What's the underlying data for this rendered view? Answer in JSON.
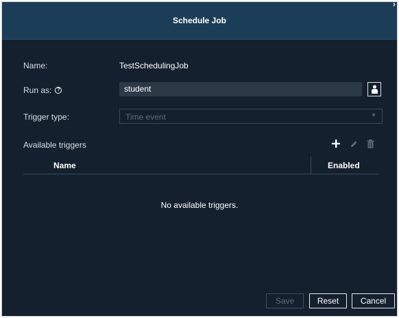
{
  "dialog": {
    "title": "Schedule Job",
    "corner_glyph": "›"
  },
  "form": {
    "name_label": "Name:",
    "name_value": "TestSchedulingJob",
    "runas_label": "Run as:",
    "runas_help_glyph": "?",
    "runas_value": "student",
    "user_picker_icon": "user-icon",
    "trigger_label": "Trigger type:",
    "trigger_value": "Time event",
    "trigger_chevron": "▼"
  },
  "triggers": {
    "section_label": "Available triggers",
    "toolbar": {
      "add_icon": "plus-icon",
      "edit_icon": "pencil-icon",
      "delete_icon": "trash-icon"
    },
    "columns": [
      "Name",
      "Enabled"
    ],
    "rows": [],
    "empty_message": "No available triggers."
  },
  "buttons": {
    "save": "Save",
    "reset": "Reset",
    "cancel": "Cancel"
  },
  "colors": {
    "dialog_bg": "#14202e",
    "title_bar_bg": "#1c3d57",
    "field_bg": "#2c3a47",
    "disabled_text": "#5b6c7c"
  }
}
